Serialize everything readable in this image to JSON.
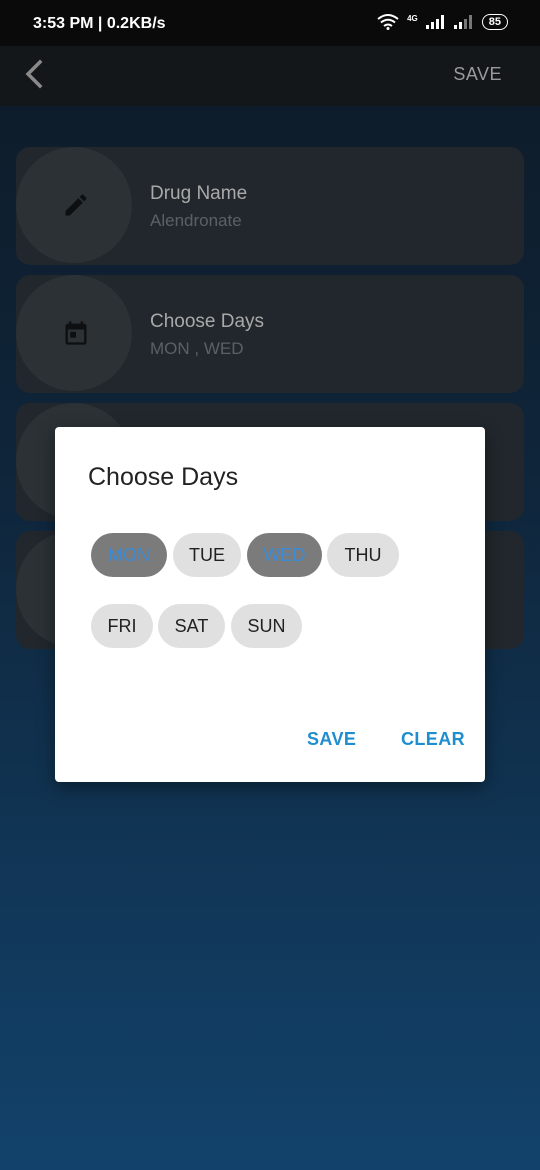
{
  "status_bar": {
    "time": "3:53 PM | 0.2KB/s",
    "network": "4G",
    "battery": "85"
  },
  "app_bar": {
    "save_label": "SAVE"
  },
  "cards": [
    {
      "title": "Drug Name",
      "subtitle": "Alendronate"
    },
    {
      "title": "Choose Days",
      "subtitle": "MON , WED"
    }
  ],
  "dialog": {
    "title": "Choose Days",
    "days": [
      {
        "label": "MON",
        "selected": true
      },
      {
        "label": "TUE",
        "selected": false
      },
      {
        "label": "WED",
        "selected": true
      },
      {
        "label": "THU",
        "selected": false
      },
      {
        "label": "FRI",
        "selected": false
      },
      {
        "label": "SAT",
        "selected": false
      },
      {
        "label": "SUN",
        "selected": false
      }
    ],
    "save_label": "SAVE",
    "clear_label": "CLEAR"
  }
}
